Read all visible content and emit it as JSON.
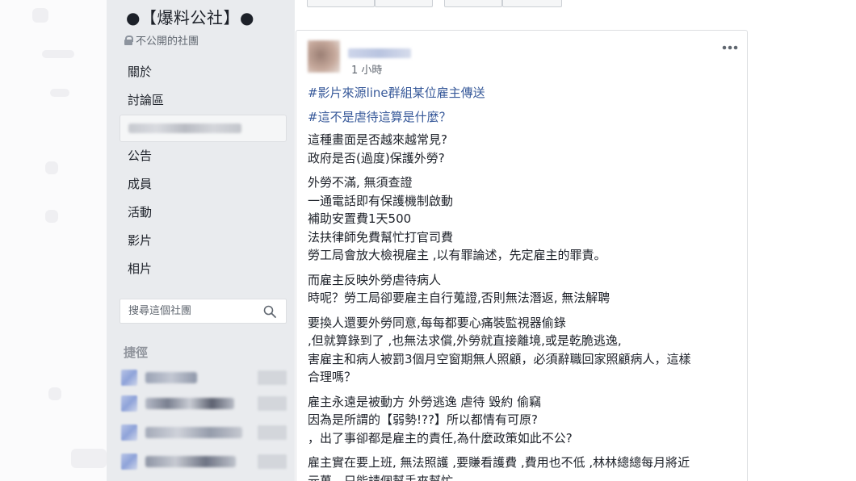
{
  "group": {
    "title": "●【爆料公社】●",
    "privacy": "不公開的社團"
  },
  "nav": {
    "items": [
      {
        "label": "關於"
      },
      {
        "label": "討論區"
      },
      {
        "label": ""
      },
      {
        "label": "公告"
      },
      {
        "label": "成員"
      },
      {
        "label": "活動"
      },
      {
        "label": "影片"
      },
      {
        "label": "相片"
      }
    ]
  },
  "search": {
    "placeholder": "搜尋這個社團",
    "value": ""
  },
  "shortcuts": {
    "title": "捷徑"
  },
  "post": {
    "timestamp": "1 小時",
    "hashtags": [
      "#影片來源line群組某位雇主傳送",
      "#這不是虐待這算是什麼？"
    ],
    "paragraphs": [
      [
        "這種畫面是否越來越常見?",
        "政府是否(過度)保護外勞?"
      ],
      [
        "外勞不滿, 無須查證",
        "一通電話即有保護機制啟動",
        "補助安置費1天500",
        "法扶律師免費幫忙打官司費",
        "勞工局會放大檢視雇主 ,以有罪論述，先定雇主的罪責。"
      ],
      [
        "而雇主反映外勞虐待病人",
        "時呢？勞工局卻要雇主自行蒐證,否則無法潛返, 無法解聘"
      ],
      [
        "要換人還要外勞同意,每每都要心痛裝監視器偷錄",
        ",但就算錄到了 ,也無法求償,外勞就直接離境,或是乾脆逃逸,",
        "害雇主和病人被罰3個月空窗期無人照顧，必須辭職回家照顧病人，這樣",
        "合理嗎？"
      ],
      [
        "雇主永遠是被動方 外勞逃逸 虐待 毀約 偷竊",
        "因為是所謂的【弱勢!??】所以都情有可原?",
        "，出了事卻都是雇主的責任,為什麼政策如此不公?"
      ],
      [
        "雇主實在要上班, 無法照護 ,要賺看護費 ,費用也不低 ,林林總總每月將近",
        "元萬，只能請個幫手來幫忙"
      ]
    ]
  },
  "colors": {
    "accent": "#365899",
    "sidebar_bg": "#e9ebee",
    "muted_text": "#606770"
  }
}
